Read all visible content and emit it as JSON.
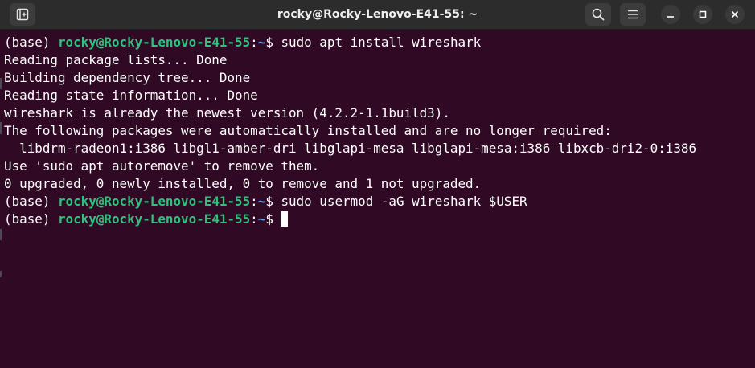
{
  "titlebar": {
    "title": "rocky@Rocky-Lenovo-E41-55: ~",
    "icons": {
      "new_tab": "new-tab-icon",
      "search": "search-icon",
      "menu": "hamburger-menu-icon",
      "minimize": "minimize-icon",
      "maximize": "maximize-icon",
      "close": "close-icon"
    }
  },
  "terminal": {
    "colors": {
      "background": "#300a24",
      "text": "#ffffff",
      "user_host": "#2ec27e",
      "path": "#5ba4ff"
    },
    "prompt": {
      "env": "(base) ",
      "user_host": "rocky@Rocky-Lenovo-E41-55",
      "colon": ":",
      "path": "~",
      "symbol": "$ "
    },
    "lines": [
      {
        "type": "prompt",
        "command": "sudo apt install wireshark"
      },
      {
        "type": "output",
        "text": "Reading package lists... Done"
      },
      {
        "type": "output",
        "text": "Building dependency tree... Done"
      },
      {
        "type": "output",
        "text": "Reading state information... Done"
      },
      {
        "type": "output",
        "text": "wireshark is already the newest version (4.2.2-1.1build3)."
      },
      {
        "type": "output",
        "text": "The following packages were automatically installed and are no longer required:"
      },
      {
        "type": "output",
        "text": "  libdrm-radeon1:i386 libgl1-amber-dri libglapi-mesa libglapi-mesa:i386 libxcb-dri2-0:i386"
      },
      {
        "type": "output",
        "text": "Use 'sudo apt autoremove' to remove them."
      },
      {
        "type": "output",
        "text": "0 upgraded, 0 newly installed, 0 to remove and 1 not upgraded."
      },
      {
        "type": "prompt",
        "command": "sudo usermod -aG wireshark $USER"
      },
      {
        "type": "prompt",
        "command": ""
      }
    ]
  }
}
